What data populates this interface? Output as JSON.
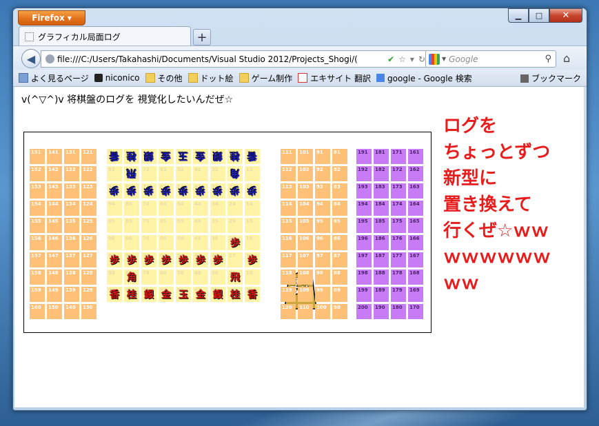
{
  "browser": {
    "app_button": "Firefox",
    "tab_title": "グラフィカル局面ログ",
    "url": "file:///C:/Users/Takahashi/Documents/Visual Studio 2012/Projects_Shogi/(",
    "search_placeholder": "Google",
    "bookmarks": [
      "よく見るページ",
      "niconico",
      "その他",
      "ドット絵",
      "ゲーム制作",
      "エキサイト 翻訳",
      "google - Google 検索"
    ],
    "bookmarks_menu": "ブックマーク"
  },
  "page": {
    "heading": "v(^▽^)v 将棋盤のログを 視覚化したいんだぜ☆",
    "note_lines": [
      "ログを",
      "ちょっとずつ",
      "新型に",
      "置き換えて",
      "行くぜ☆ｗｗ",
      "ｗｗｗｗｗｗ",
      "ｗｗ"
    ],
    "turn_piece": {
      "top": "手番",
      "bottom": "攻め"
    }
  },
  "board": {
    "left_orange_cols": [
      [
        "151",
        "152",
        "153",
        "154",
        "155",
        "156",
        "157",
        "158",
        "159",
        "160"
      ],
      [
        "141",
        "142",
        "143",
        "144",
        "145",
        "146",
        "147",
        "148",
        "149",
        "150"
      ],
      [
        "131",
        "132",
        "133",
        "134",
        "135",
        "136",
        "137",
        "138",
        "139",
        "140"
      ],
      [
        "121",
        "122",
        "123",
        "124",
        "125",
        "126",
        "127",
        "128",
        "129",
        "130"
      ]
    ],
    "main_cols": [
      [
        "91",
        "92",
        "93",
        "94",
        "95",
        "96",
        "97",
        "98",
        "99"
      ],
      [
        "81",
        "82",
        "83",
        "84",
        "85",
        "86",
        "87",
        "88",
        "89"
      ],
      [
        "71",
        "72",
        "73",
        "74",
        "75",
        "76",
        "77",
        "78",
        "79"
      ],
      [
        "61",
        "62",
        "63",
        "64",
        "65",
        "66",
        "67",
        "68",
        "69"
      ],
      [
        "51",
        "52",
        "53",
        "54",
        "55",
        "56",
        "57",
        "58",
        "59"
      ],
      [
        "41",
        "42",
        "43",
        "44",
        "45",
        "46",
        "47",
        "48",
        "49"
      ],
      [
        "31",
        "32",
        "33",
        "34",
        "35",
        "36",
        "37",
        "38",
        "39"
      ],
      [
        "21",
        "22",
        "23",
        "24",
        "25",
        "26",
        "27",
        "28",
        "29"
      ],
      [
        "11",
        "12",
        "13",
        "14",
        "15",
        "16",
        "17",
        "18",
        "19"
      ]
    ],
    "right_orange_cols": [
      [
        "111",
        "112",
        "113",
        "114",
        "115",
        "116",
        "117",
        "118",
        "119",
        "120"
      ],
      [
        "101",
        "102",
        "103",
        "104",
        "105",
        "106",
        "107",
        "108",
        "109",
        "110"
      ],
      [
        "91",
        "92",
        "93",
        "94",
        "95",
        "96",
        "97",
        "98",
        "99",
        "100"
      ],
      [
        "81",
        "82",
        "83",
        "84",
        "85",
        "86",
        "87",
        "88",
        "89",
        "90"
      ]
    ],
    "purple_cols": [
      [
        "191",
        "192",
        "193",
        "194",
        "195",
        "196",
        "197",
        "198",
        "199",
        "200"
      ],
      [
        "181",
        "182",
        "183",
        "184",
        "185",
        "186",
        "187",
        "188",
        "189",
        "190"
      ],
      [
        "171",
        "172",
        "173",
        "174",
        "175",
        "176",
        "177",
        "178",
        "179",
        "180"
      ],
      [
        "161",
        "162",
        "163",
        "164",
        "165",
        "166",
        "167",
        "168",
        "169",
        "170"
      ]
    ],
    "gote_pieces": [
      {
        "col": 0,
        "row": 0,
        "t": "香"
      },
      {
        "col": 1,
        "row": 0,
        "t": "桂"
      },
      {
        "col": 2,
        "row": 0,
        "t": "銀"
      },
      {
        "col": 3,
        "row": 0,
        "t": "金"
      },
      {
        "col": 4,
        "row": 0,
        "t": "玉"
      },
      {
        "col": 5,
        "row": 0,
        "t": "金"
      },
      {
        "col": 6,
        "row": 0,
        "t": "銀"
      },
      {
        "col": 7,
        "row": 0,
        "t": "桂"
      },
      {
        "col": 8,
        "row": 0,
        "t": "香"
      },
      {
        "col": 1,
        "row": 1,
        "t": "飛"
      },
      {
        "col": 7,
        "row": 1,
        "t": "角"
      },
      {
        "col": 0,
        "row": 2,
        "t": "歩"
      },
      {
        "col": 1,
        "row": 2,
        "t": "歩"
      },
      {
        "col": 2,
        "row": 2,
        "t": "歩"
      },
      {
        "col": 3,
        "row": 2,
        "t": "歩"
      },
      {
        "col": 4,
        "row": 2,
        "t": "歩"
      },
      {
        "col": 5,
        "row": 2,
        "t": "歩"
      },
      {
        "col": 6,
        "row": 2,
        "t": "歩"
      },
      {
        "col": 7,
        "row": 2,
        "t": "歩"
      },
      {
        "col": 8,
        "row": 2,
        "t": "歩"
      }
    ],
    "sente_pieces": [
      {
        "col": 7,
        "row": 5,
        "t": "歩"
      },
      {
        "col": 0,
        "row": 6,
        "t": "歩"
      },
      {
        "col": 1,
        "row": 6,
        "t": "歩"
      },
      {
        "col": 2,
        "row": 6,
        "t": "歩"
      },
      {
        "col": 3,
        "row": 6,
        "t": "歩"
      },
      {
        "col": 4,
        "row": 6,
        "t": "歩"
      },
      {
        "col": 5,
        "row": 6,
        "t": "歩"
      },
      {
        "col": 6,
        "row": 6,
        "t": "歩"
      },
      {
        "col": 8,
        "row": 6,
        "t": "歩"
      },
      {
        "col": 1,
        "row": 7,
        "t": "角"
      },
      {
        "col": 7,
        "row": 7,
        "t": "飛"
      },
      {
        "col": 0,
        "row": 8,
        "t": "香"
      },
      {
        "col": 1,
        "row": 8,
        "t": "桂"
      },
      {
        "col": 2,
        "row": 8,
        "t": "銀"
      },
      {
        "col": 3,
        "row": 8,
        "t": "金"
      },
      {
        "col": 4,
        "row": 8,
        "t": "玉"
      },
      {
        "col": 5,
        "row": 8,
        "t": "金"
      },
      {
        "col": 6,
        "row": 8,
        "t": "銀"
      },
      {
        "col": 7,
        "row": 8,
        "t": "桂"
      },
      {
        "col": 8,
        "row": 8,
        "t": "香"
      }
    ]
  }
}
